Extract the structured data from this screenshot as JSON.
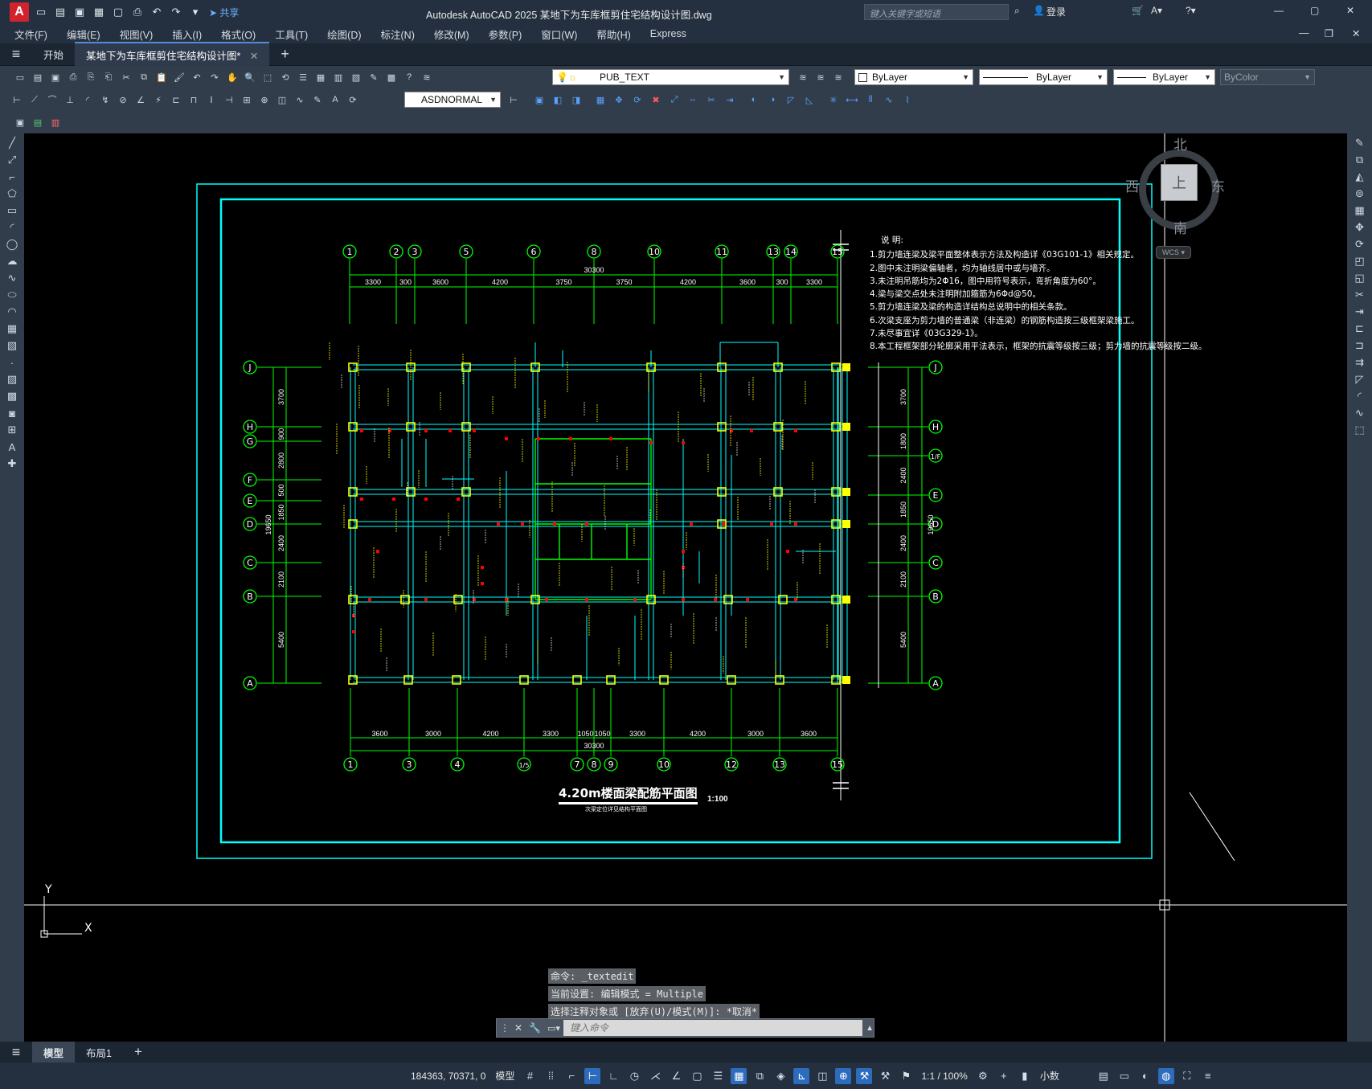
{
  "titlebar": {
    "app_letter": "A",
    "share_label": "共享",
    "title": "Autodesk AutoCAD 2025    某地下为车库框剪住宅结构设计图.dwg",
    "search_placeholder": "键入关键字或短语",
    "login_label": "登录"
  },
  "menu": [
    "文件(F)",
    "编辑(E)",
    "视图(V)",
    "插入(I)",
    "格式(O)",
    "工具(T)",
    "绘图(D)",
    "标注(N)",
    "修改(M)",
    "参数(P)",
    "窗口(W)",
    "帮助(H)",
    "Express"
  ],
  "tabs": {
    "start": "开始",
    "active_doc": "某地下为车库框剪住宅结构设计图*"
  },
  "layer_combo": "PUB_TEXT",
  "color_combo": "ByLayer",
  "linetype_combo": "ByLayer",
  "lineweight_combo": "ByLayer",
  "plotstyle_combo": "ByColor",
  "dimstyle_combo": "ASDNORMAL",
  "viewcube": {
    "north": "北",
    "south": "南",
    "east": "东",
    "west": "西",
    "top": "上",
    "wcs": "WCS"
  },
  "drawing": {
    "title": "4.20m楼面梁配筋平面图",
    "scale": "1:100",
    "subtitle": "次梁定位详见结构平面图",
    "notes_title": "说 明:",
    "notes": [
      "1.剪力墙连梁及梁平面整体表示方法及构造详《03G101-1》相关规定。",
      "2.图中未注明梁偏轴者，均为轴线居中或与墙齐。",
      "3.未注明吊筋均为2Φ16，图中用符号表示，弯折角度为60°。",
      "4.梁与梁交点处未注明附加箍筋为6Φd@50。",
      "5.剪力墙连梁及梁的构造详结构总说明中的相关条款。",
      "6.次梁支座为剪力墙的普通梁（非连梁）的钢筋构造按三级框架梁施工。",
      "7.未尽事宜详《03G329-1》。",
      "8.本工程框架部分轮廓采用平法表示，框架的抗震等级按三级；剪力墙的抗震等级按二级。"
    ],
    "top_axes": [
      "1",
      "2",
      "3",
      "5",
      "6",
      "8",
      "10",
      "11",
      "13",
      "14",
      "15"
    ],
    "top_dims": [
      "3300",
      "300",
      "3600",
      "4200",
      "3750",
      "3750",
      "4200",
      "3600",
      "300",
      "3300"
    ],
    "top_total": "30300",
    "bottom_axes": [
      "1",
      "3",
      "4",
      "1/5",
      "7",
      "8",
      "9",
      "10",
      "12",
      "13",
      "15"
    ],
    "bottom_dims": [
      "3600",
      "3000",
      "4200",
      "3300",
      "1050",
      "1050",
      "3300",
      "4200",
      "3000",
      "3600"
    ],
    "bottom_total": "30300",
    "left_axes": [
      "J",
      "H",
      "G",
      "F",
      "E",
      "D",
      "C",
      "B",
      "A"
    ],
    "left_dims": [
      "3700",
      "900",
      "2800",
      "500",
      "1850",
      "2400",
      "2100",
      "5400"
    ],
    "left_total": "19650",
    "right_axes": [
      "J",
      "H",
      "1/F",
      "E",
      "D",
      "C",
      "B",
      "A"
    ],
    "right_dims": [
      "3700",
      "1800",
      "2400",
      "1850",
      "2400",
      "2100",
      "5400"
    ],
    "right_total": "19650"
  },
  "command": {
    "history": [
      "命令: _textedit",
      "当前设置: 编辑模式 = Multiple",
      "选择注释对象或 [放弃(U)/模式(M)]: *取消*"
    ],
    "placeholder": "键入命令"
  },
  "layout_tabs": [
    "模型",
    "布局1"
  ],
  "status": {
    "coords": "184363, 70371, 0",
    "model": "模型",
    "scale": "1:1 / 100%",
    "units": "小数"
  },
  "colors": {
    "accent": "#2d6bbd",
    "axis_green": "#00ff00",
    "frame_cyan": "#00ffff",
    "column_yellow": "#ffff00",
    "rebar_red": "#ff0000"
  }
}
